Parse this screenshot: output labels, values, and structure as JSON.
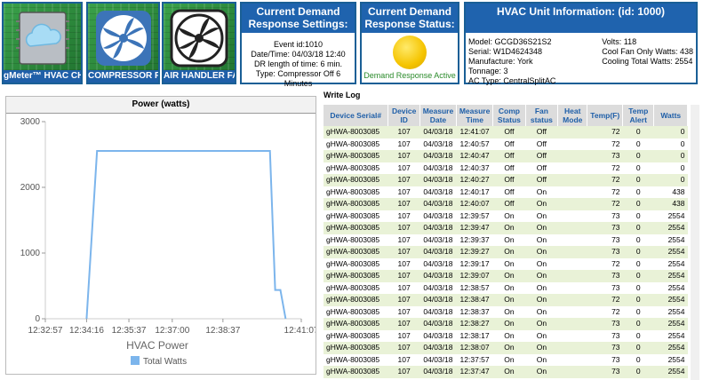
{
  "tiles": [
    {
      "label": "gMeter™ HVAC CHIP",
      "icon": "cloud-chip-icon"
    },
    {
      "label": "COMPRESSOR FAN",
      "icon": "compressor-fan-icon"
    },
    {
      "label": "AIR HANDLER FAN",
      "icon": "air-handler-fan-icon"
    }
  ],
  "dr_settings": {
    "title": "Current Demand Response Settings:",
    "event": "Event id:1010",
    "datetime": "Date/Time: 04/03/18 12:40",
    "length": "DR length of time: 6 min.",
    "type": "Type: Compressor Off 6 Minutes"
  },
  "dr_status": {
    "title": "Current Demand Response Status:",
    "status": "Demand Response Active",
    "indicator_color": "#f5c400"
  },
  "hvac": {
    "title": "HVAC Unit Information: (id: 1000)",
    "model": "Model: GCGD36S21S2",
    "serial": "Serial: W1D4624348",
    "manufacture": "Manufacture: York",
    "tonnage": "Tonnage: 3",
    "ac_type": "AC Type: CentralSplitAC",
    "volts": "Volts: 118",
    "cool_fan_watts": "Cool Fan Only Watts: 438",
    "cooling_total_watts": "Cooling Total Watts: 2554"
  },
  "chart_panel_title": "Power (watts)",
  "chart_data": {
    "type": "line",
    "title": "HVAC Power",
    "x_ticks": [
      "12:32:57",
      "12:34:16",
      "12:35:37",
      "12:37:00",
      "12:38:37",
      "12:41:07"
    ],
    "y_ticks": [
      "0",
      "1000",
      "2000",
      "3000"
    ],
    "ylim": [
      0,
      3000
    ],
    "series": [
      {
        "name": "Total Watts",
        "color": "#7cb5ec",
        "points": [
          {
            "t": "12:34:16",
            "v": 0
          },
          {
            "t": "12:34:36",
            "v": 2554
          },
          {
            "t": "12:40:07",
            "v": 2554
          },
          {
            "t": "12:40:17",
            "v": 438
          },
          {
            "t": "12:40:27",
            "v": 438
          },
          {
            "t": "12:40:37",
            "v": 0
          }
        ]
      }
    ]
  },
  "write_log": {
    "title": "Write Log",
    "columns": [
      "Device Serial#",
      "Device ID",
      "Measure Date",
      "Measure Time",
      "Comp Status",
      "Fan status",
      "Heat Mode",
      "Temp(F)",
      "Temp Alert",
      "Watts"
    ],
    "rows": [
      [
        "gHWA-8003085",
        "107",
        "04/03/18",
        "12:41:07",
        "Off",
        "Off",
        "",
        "72",
        "0",
        "0"
      ],
      [
        "gHWA-8003085",
        "107",
        "04/03/18",
        "12:40:57",
        "Off",
        "Off",
        "",
        "72",
        "0",
        "0"
      ],
      [
        "gHWA-8003085",
        "107",
        "04/03/18",
        "12:40:47",
        "Off",
        "Off",
        "",
        "73",
        "0",
        "0"
      ],
      [
        "gHWA-8003085",
        "107",
        "04/03/18",
        "12:40:37",
        "Off",
        "Off",
        "",
        "72",
        "0",
        "0"
      ],
      [
        "gHWA-8003085",
        "107",
        "04/03/18",
        "12:40:27",
        "Off",
        "Off",
        "",
        "72",
        "0",
        "0"
      ],
      [
        "gHWA-8003085",
        "107",
        "04/03/18",
        "12:40:17",
        "Off",
        "On",
        "",
        "72",
        "0",
        "438"
      ],
      [
        "gHWA-8003085",
        "107",
        "04/03/18",
        "12:40:07",
        "Off",
        "On",
        "",
        "72",
        "0",
        "438"
      ],
      [
        "gHWA-8003085",
        "107",
        "04/03/18",
        "12:39:57",
        "On",
        "On",
        "",
        "73",
        "0",
        "2554"
      ],
      [
        "gHWA-8003085",
        "107",
        "04/03/18",
        "12:39:47",
        "On",
        "On",
        "",
        "73",
        "0",
        "2554"
      ],
      [
        "gHWA-8003085",
        "107",
        "04/03/18",
        "12:39:37",
        "On",
        "On",
        "",
        "73",
        "0",
        "2554"
      ],
      [
        "gHWA-8003085",
        "107",
        "04/03/18",
        "12:39:27",
        "On",
        "On",
        "",
        "73",
        "0",
        "2554"
      ],
      [
        "gHWA-8003085",
        "107",
        "04/03/18",
        "12:39:17",
        "On",
        "On",
        "",
        "72",
        "0",
        "2554"
      ],
      [
        "gHWA-8003085",
        "107",
        "04/03/18",
        "12:39:07",
        "On",
        "On",
        "",
        "73",
        "0",
        "2554"
      ],
      [
        "gHWA-8003085",
        "107",
        "04/03/18",
        "12:38:57",
        "On",
        "On",
        "",
        "73",
        "0",
        "2554"
      ],
      [
        "gHWA-8003085",
        "107",
        "04/03/18",
        "12:38:47",
        "On",
        "On",
        "",
        "72",
        "0",
        "2554"
      ],
      [
        "gHWA-8003085",
        "107",
        "04/03/18",
        "12:38:37",
        "On",
        "On",
        "",
        "72",
        "0",
        "2554"
      ],
      [
        "gHWA-8003085",
        "107",
        "04/03/18",
        "12:38:27",
        "On",
        "On",
        "",
        "73",
        "0",
        "2554"
      ],
      [
        "gHWA-8003085",
        "107",
        "04/03/18",
        "12:38:17",
        "On",
        "On",
        "",
        "73",
        "0",
        "2554"
      ],
      [
        "gHWA-8003085",
        "107",
        "04/03/18",
        "12:38:07",
        "On",
        "On",
        "",
        "73",
        "0",
        "2554"
      ],
      [
        "gHWA-8003085",
        "107",
        "04/03/18",
        "12:37:57",
        "On",
        "On",
        "",
        "73",
        "0",
        "2554"
      ],
      [
        "gHWA-8003085",
        "107",
        "04/03/18",
        "12:37:47",
        "On",
        "On",
        "",
        "73",
        "0",
        "2554"
      ]
    ]
  }
}
